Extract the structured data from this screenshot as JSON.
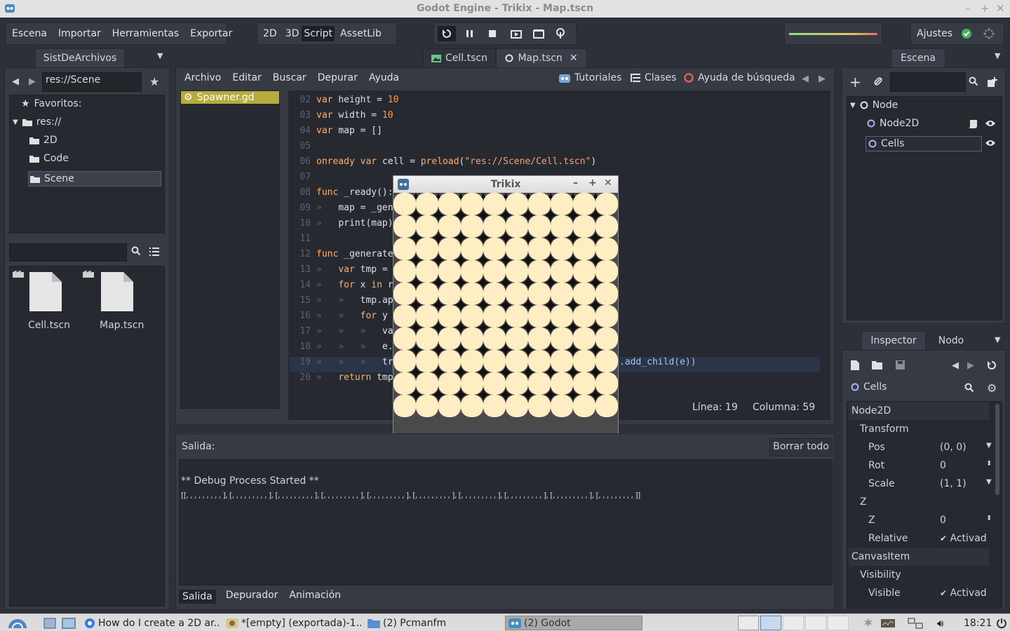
{
  "window_title": "Godot Engine - Trikix - Map.tscn",
  "menus": [
    "Escena",
    "Importar",
    "Herramientas",
    "Exportar"
  ],
  "modes": [
    "2D",
    "3D",
    "Script",
    "AssetLib"
  ],
  "settings_label": "Ajustes",
  "filesystem": {
    "tab": "SistDeArchivos",
    "path": "res://Scene",
    "tree": [
      "Favoritos:",
      "res://",
      "2D",
      "Code",
      "Scene"
    ],
    "files": [
      "Cell.tscn",
      "Map.tscn"
    ]
  },
  "scene_tabs": [
    "Cell.tscn",
    "Map.tscn"
  ],
  "script_menu": [
    "Archivo",
    "Editar",
    "Buscar",
    "Depurar",
    "Ayuda"
  ],
  "script_links": [
    "Tutoriales",
    "Clases",
    "Ayuda de búsqueda"
  ],
  "script_list": [
    "Spawner.gd"
  ],
  "code_lines": [
    {
      "n": "02",
      "t": "var height = 10"
    },
    {
      "n": "03",
      "t": "var width = 10"
    },
    {
      "n": "04",
      "t": "var map = []"
    },
    {
      "n": "05",
      "t": ""
    },
    {
      "n": "06",
      "t": "onready var cell = preload(\"res://Scene/Cell.tscn\")"
    },
    {
      "n": "07",
      "t": ""
    },
    {
      "n": "08",
      "t": "func _ready():"
    },
    {
      "n": "09",
      "t": "»   map = _gen"
    },
    {
      "n": "10",
      "t": "»   print(map)"
    },
    {
      "n": "11",
      "t": ""
    },
    {
      "n": "12",
      "t": "func _generate"
    },
    {
      "n": "13",
      "t": "»   var tmp ="
    },
    {
      "n": "14",
      "t": "»   for x in r"
    },
    {
      "n": "15",
      "t": "»   »   tmp.ap"
    },
    {
      "n": "16",
      "t": "»   »   for y"
    },
    {
      "n": "17",
      "t": "»   »   »   va"
    },
    {
      "n": "18",
      "t": "»   »   »   e."
    },
    {
      "n": "19",
      "t": "»   »   »   tr"
    },
    {
      "n": "20",
      "t": "»   return tmp"
    }
  ],
  "code_tail_19": ".add_child(e))",
  "status": {
    "line": "Línea: 19",
    "column": "Columna: 59"
  },
  "game_window_title": "Trikix",
  "output": {
    "label": "Salida:",
    "clear": "Borrar todo",
    "line1": "** Debug Process Started **",
    "line2": "[[, , , , , , , , , ], [, , , , , , , , , ], [, , , , , , , , , ], [, , , , , , , , , ], [, , , , , , , , , ], [, , , , , , , , , ], [, , , , , , , , , ], [, , , , , , , , , ], [, , , , , , , , , ], [, , , , , , , , , ]]",
    "tabs": [
      "Salida",
      "Depurador",
      "Animación"
    ]
  },
  "scene_dock": {
    "tab": "Escena",
    "nodes": [
      "Node",
      "Node2D",
      "Cells"
    ]
  },
  "inspector": {
    "tabs": [
      "Inspector",
      "Nodo"
    ],
    "object": "Cells",
    "rows": [
      {
        "k": "Node2D",
        "v": ""
      },
      {
        "k": "Transform",
        "v": ""
      },
      {
        "k": "Pos",
        "v": "(0, 0)"
      },
      {
        "k": "Rot",
        "v": "0"
      },
      {
        "k": "Scale",
        "v": "(1, 1)"
      },
      {
        "k": "Z",
        "v": ""
      },
      {
        "k": "Z",
        "v": "0"
      },
      {
        "k": "Relative",
        "v": "Activad"
      },
      {
        "k": "CanvasItem",
        "v": ""
      },
      {
        "k": "Visibility",
        "v": ""
      },
      {
        "k": "Visible",
        "v": "Activad"
      }
    ]
  },
  "taskbar": {
    "items": [
      "How do I create a 2D ar...",
      "*[empty] (exportada)-1...",
      "(2) Pcmanfm",
      "(2) Godot"
    ],
    "clock": "18:21"
  },
  "colors": {
    "accent": "#d0c8a0",
    "tile": "#ffeec4",
    "selected_file": "#b5ac3d"
  }
}
